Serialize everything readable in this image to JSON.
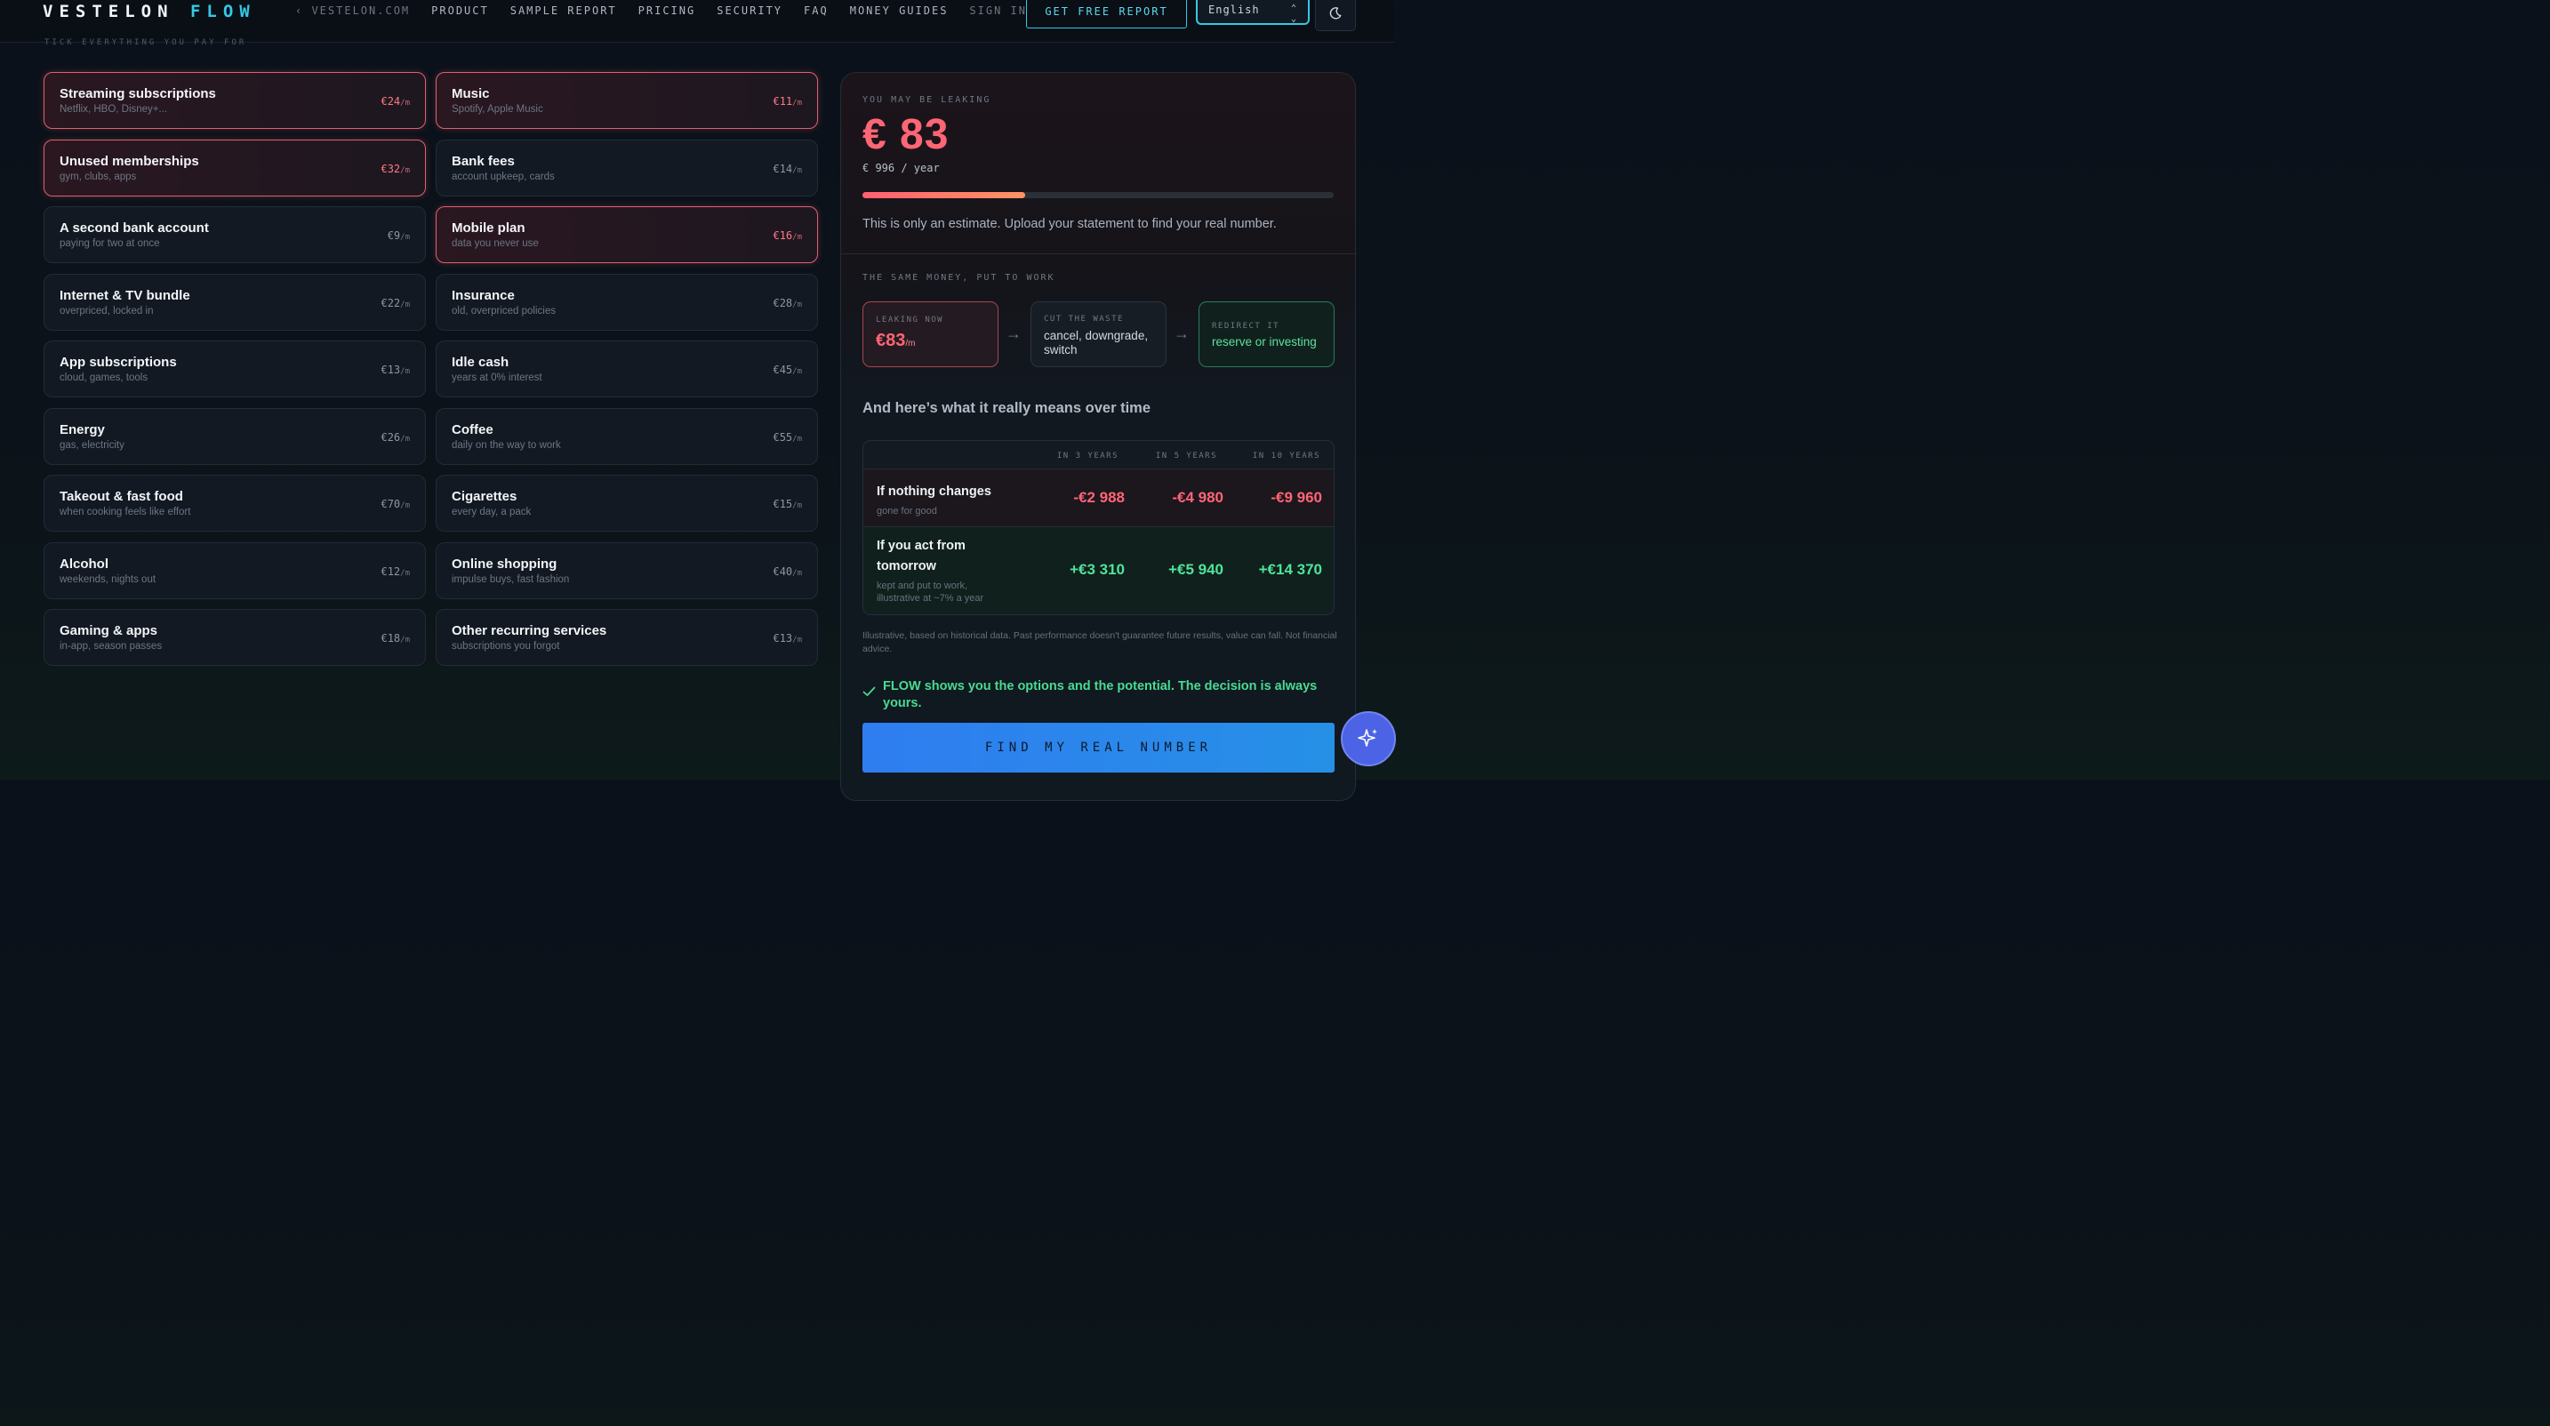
{
  "nav": {
    "brand_left": "VESTELON",
    "brand_right": "FLOW",
    "links": [
      {
        "label": "‹ VESTELON.COM",
        "dim": true
      },
      {
        "label": "PRODUCT"
      },
      {
        "label": "SAMPLE REPORT"
      },
      {
        "label": "PRICING"
      },
      {
        "label": "SECURITY"
      },
      {
        "label": "FAQ"
      },
      {
        "label": "MONEY GUIDES"
      },
      {
        "label": "SIGN IN"
      }
    ],
    "cta": "GET FREE REPORT",
    "language": "English",
    "theme_icon": "moon-icon"
  },
  "section_label": "TICK EVERYTHING YOU PAY FOR",
  "expenses": [
    {
      "title": "Streaming subscriptions",
      "sub": "Netflix, HBO, Disney+...",
      "price": "€24",
      "unit": "/m",
      "selected": true
    },
    {
      "title": "Music",
      "sub": "Spotify, Apple Music",
      "price": "€11",
      "unit": "/m",
      "selected": true
    },
    {
      "title": "Unused memberships",
      "sub": "gym, clubs, apps",
      "price": "€32",
      "unit": "/m",
      "selected": true
    },
    {
      "title": "Bank fees",
      "sub": "account upkeep, cards",
      "price": "€14",
      "unit": "/m",
      "selected": false
    },
    {
      "title": "A second bank account",
      "sub": "paying for two at once",
      "price": "€9",
      "unit": "/m",
      "selected": false
    },
    {
      "title": "Mobile plan",
      "sub": "data you never use",
      "price": "€16",
      "unit": "/m",
      "selected": true
    },
    {
      "title": "Internet & TV bundle",
      "sub": "overpriced, locked in",
      "price": "€22",
      "unit": "/m",
      "selected": false
    },
    {
      "title": "Insurance",
      "sub": "old, overpriced policies",
      "price": "€28",
      "unit": "/m",
      "selected": false
    },
    {
      "title": "App subscriptions",
      "sub": "cloud, games, tools",
      "price": "€13",
      "unit": "/m",
      "selected": false
    },
    {
      "title": "Idle cash",
      "sub": "years at 0% interest",
      "price": "€45",
      "unit": "/m",
      "selected": false
    },
    {
      "title": "Energy",
      "sub": "gas, electricity",
      "price": "€26",
      "unit": "/m",
      "selected": false
    },
    {
      "title": "Coffee",
      "sub": "daily on the way to work",
      "price": "€55",
      "unit": "/m",
      "selected": false
    },
    {
      "title": "Takeout & fast food",
      "sub": "when cooking feels like effort",
      "price": "€70",
      "unit": "/m",
      "selected": false
    },
    {
      "title": "Cigarettes",
      "sub": "every day, a pack",
      "price": "€15",
      "unit": "/m",
      "selected": false
    },
    {
      "title": "Alcohol",
      "sub": "weekends, nights out",
      "price": "€12",
      "unit": "/m",
      "selected": false
    },
    {
      "title": "Online shopping",
      "sub": "impulse buys, fast fashion",
      "price": "€40",
      "unit": "/m",
      "selected": false
    },
    {
      "title": "Gaming & apps",
      "sub": "in-app, season passes",
      "price": "€18",
      "unit": "/m",
      "selected": false
    },
    {
      "title": "Other recurring services",
      "sub": "subscriptions you forgot",
      "price": "€13",
      "unit": "/m",
      "selected": false
    }
  ],
  "summary": {
    "label": "YOU MAY BE LEAKING",
    "amount": "€ 83",
    "per_year": "€ 996 / year",
    "progress_fraction": 0.345,
    "estimate_note": "This is only an estimate. Upload your statement to find your real number."
  },
  "flow": {
    "label": "THE SAME MONEY, PUT TO WORK",
    "leaking_label": "LEAKING NOW",
    "leaking_value": "€83",
    "leaking_unit": "/m",
    "cut_label": "CUT THE WASTE",
    "cut_text": "cancel, downgrade, switch",
    "redirect_label": "REDIRECT IT",
    "redirect_text": "reserve or investing"
  },
  "over_time": {
    "heading": "And here’s what it really means over time",
    "columns": [
      "IN 3 YEARS",
      "IN 5 YEARS",
      "IN 10 YEARS"
    ],
    "rows": [
      {
        "title": "If nothing changes",
        "sub": "gone for good",
        "values": [
          "-€2 988",
          "-€4 980",
          "-€9 960"
        ]
      },
      {
        "title": "If you act from tomorrow",
        "sub": "kept and put to work, illustrative at ~7% a year",
        "values": [
          "+€3 310",
          "+€5 940",
          "+€14 370"
        ]
      }
    ]
  },
  "disclaimer": "Illustrative, based on historical data. Past performance doesn't guarantee future results, value can fall. Not financial advice.",
  "decision_note": "FLOW shows you the options and the potential. The decision is always yours.",
  "cta_button": "FIND MY REAL NUMBER",
  "colors": {
    "accent": "#35c8e6",
    "leak": "#ff6675",
    "gain": "#4fe39a",
    "button": "#2f7df0"
  }
}
